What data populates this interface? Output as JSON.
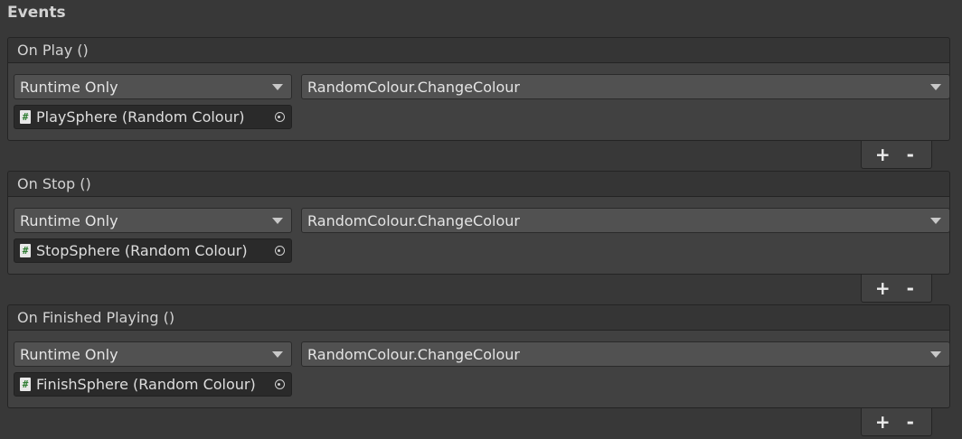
{
  "section_title": "Events",
  "events": [
    {
      "header": "On Play ()",
      "mode": "Runtime Only",
      "function": "RandomColour.ChangeColour",
      "object": "PlaySphere (Random Colour)",
      "script_icon_glyph": "#",
      "add_label": "+",
      "remove_label": "-"
    },
    {
      "header": "On Stop ()",
      "mode": "Runtime Only",
      "function": "RandomColour.ChangeColour",
      "object": "StopSphere (Random Colour)",
      "script_icon_glyph": "#",
      "add_label": "+",
      "remove_label": "-"
    },
    {
      "header": "On Finished Playing ()",
      "mode": "Runtime Only",
      "function": "RandomColour.ChangeColour",
      "object": "FinishSphere (Random Colour)",
      "script_icon_glyph": "#",
      "add_label": "+",
      "remove_label": "-"
    }
  ],
  "icons": {
    "script": "csharp-script-icon",
    "object_picker": "object-picker-target-icon",
    "dropdown": "dropdown-arrow-icon"
  },
  "colors": {
    "background": "#383838",
    "panel": "#414141",
    "header": "#353535",
    "dropdown": "#515151",
    "object_field": "#2a2a2a"
  }
}
